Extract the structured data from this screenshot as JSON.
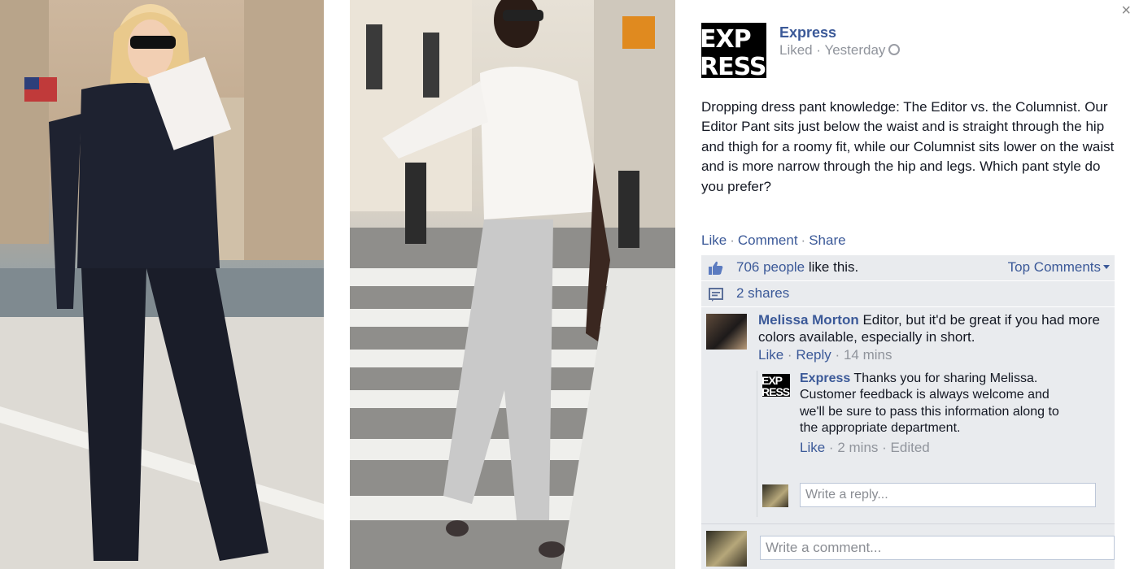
{
  "close_label": "×",
  "page": {
    "name": "Express",
    "logo_text": [
      "EXP",
      "RESS"
    ]
  },
  "post": {
    "meta": "Liked · Yesterday",
    "text": "Dropping dress pant knowledge: The Editor vs. the Columnist. Our Editor Pant sits just below the waist and is straight through the hip and thigh for a roomy fit, while our Columnist sits lower on the waist and is more narrow through the hip and legs. Which pant style do you prefer?",
    "actions": {
      "like": "Like",
      "comment": "Comment",
      "share": "Share",
      "separator": "·"
    }
  },
  "ufi": {
    "likes_link": "706 people",
    "likes_text": " like this.",
    "top_comments": "Top Comments",
    "shares": "2 shares"
  },
  "comment": {
    "author": "Melissa Morton",
    "text": " Editor, but it'd be great if you had more colors available, especially in short.",
    "like": "Like",
    "reply": "Reply",
    "time": "14 mins",
    "separator": "·"
  },
  "reply": {
    "author": "Express",
    "text": " Thanks you for sharing Melissa. Customer feedback is always welcome and we'll be sure to pass this information along to the appropriate department.",
    "like": "Like",
    "time": "2 mins",
    "edited": "Edited",
    "separator": "·",
    "avatar_text": [
      "EXP",
      "RESS"
    ]
  },
  "inputs": {
    "reply_placeholder": "Write a reply...",
    "comment_placeholder": "Write a comment..."
  },
  "colors": {
    "link": "#3b5998",
    "muted": "#90949c",
    "ufi_bg": "#e9ebee"
  },
  "icons": {
    "like": "thumbs-up-icon",
    "share": "share-icon",
    "audience": "globe-icon",
    "close": "close-icon"
  }
}
